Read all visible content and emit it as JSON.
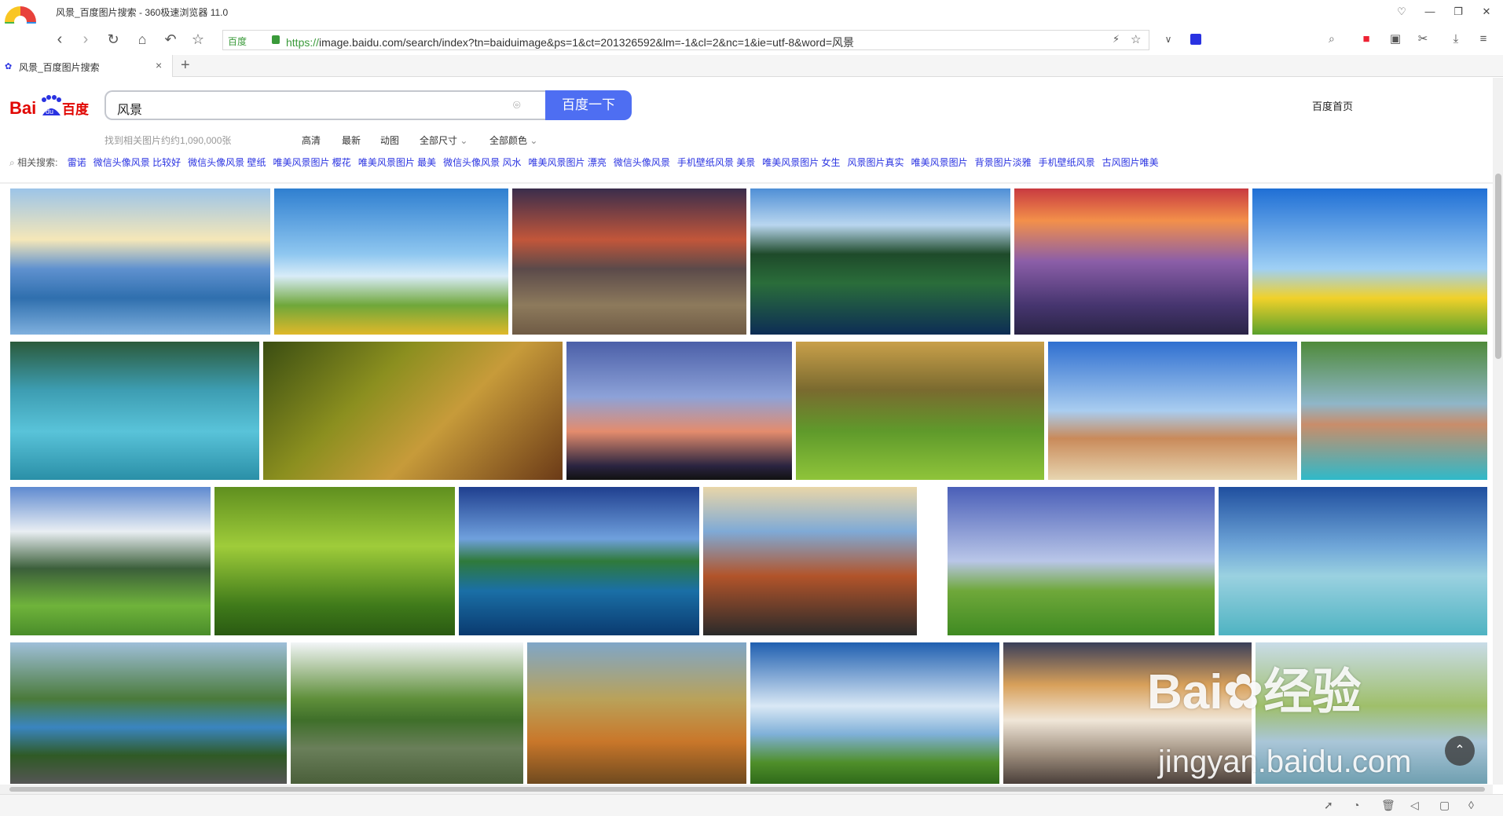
{
  "window": {
    "title": "风景_百度图片搜索 - 360极速浏览器 11.0"
  },
  "address_bar": {
    "site_badge": "百度",
    "url_scheme": "https://",
    "url_rest": "image.baidu.com/search/index?tn=baiduimage&ps=1&ct=201326592&lm=-1&cl=2&nc=1&ie=utf-8&word=风景"
  },
  "tab": {
    "label": "风景_百度图片搜索",
    "favicon": "baidu-paw-icon"
  },
  "page": {
    "logo_text": "Bai百度",
    "search": {
      "query": "风景",
      "button_label": "百度一下"
    },
    "home_link": "百度首页",
    "result_count": "找到相关图片约约1,090,000张",
    "filters": [
      "高清",
      "最新",
      "动图",
      "全部尺寸",
      "全部颜色"
    ],
    "related_label": "相关搜索:",
    "related_links": [
      "雷诺",
      "微信头像风景 比较好",
      "微信头像风景 壁纸",
      "唯美风景图片 樱花",
      "唯美风景图片 最美",
      "微信头像风景 风水",
      "唯美风景图片 漂亮",
      "微信头像风景",
      "手机壁纸风景 美景",
      "唯美风景图片 女生",
      "风景图片真实",
      "唯美风景图片",
      "背景图片淡雅",
      "手机壁纸风景",
      "古风图片唯美"
    ]
  },
  "images": [
    {
      "name": "lake-sky-reflection",
      "bg": "linear-gradient(180deg,#9cc4e8 0%,#f5e7b8 35%,#5f91cf 55%,#2f6fae 75%,#7fb0de 100%)"
    },
    {
      "name": "sunflowers-city",
      "bg": "linear-gradient(180deg,#2f7fd0 0%,#8fc7f0 45%,#d8ecf8 60%,#6fa73a 80%,#e0b82a 100%)"
    },
    {
      "name": "sunset-hills",
      "bg": "linear-gradient(180deg,#3a2d4c 0%,#c2563a 35%,#5b4a4a 55%,#8d7a5c 80%,#6f5b45 100%)"
    },
    {
      "name": "mountain-forest-lake",
      "bg": "linear-gradient(180deg,#4f8fd6 0%,#b9d6ef 25%,#1e4a2a 45%,#2a6d3a 65%,#0d2d55 100%)"
    },
    {
      "name": "pink-sunset-sea",
      "bg": "linear-gradient(180deg,#c83a40 0%,#f3904a 22%,#8b5ea8 50%,#46356f 80%,#2a2445 100%)"
    },
    {
      "name": "butterfly-flowers",
      "bg": "linear-gradient(180deg,#1f6fd5 0%,#9fd0f5 55%,#f1d12a 75%,#5aa12c 100%)"
    },
    {
      "name": "turquoise-lake",
      "bg": "linear-gradient(180deg,#2b5a3b 0%,#3d9db2 35%,#59c3d9 65%,#2a8fa7 100%)"
    },
    {
      "name": "autumn-forest-path",
      "bg": "linear-gradient(135deg,#3a4d12 0%,#8b8f1f 35%,#c79b3a 60%,#6b3a17 100%)"
    },
    {
      "name": "sun-rays-sky",
      "bg": "linear-gradient(180deg,#4b5fa8 0%,#8da2d8 40%,#e48c6d 65%,#2a2440 90%,#111 100%)"
    },
    {
      "name": "sunlit-woods",
      "bg": "linear-gradient(180deg,#c9a04a 0%,#7a6a2f 35%,#5f9a2b 65%,#8fc43a 100%)"
    },
    {
      "name": "desert-rock",
      "bg": "linear-gradient(180deg,#2f6fd0 0%,#a9cdf0 50%,#c98a5a 70%,#e7d5b0 100%)"
    },
    {
      "name": "lakeside-village",
      "bg": "linear-gradient(180deg,#4f8a3a 0%,#8fb6c9 45%,#c98d6a 60%,#2fb9c9 100%)"
    },
    {
      "name": "alpine-chalet",
      "bg": "linear-gradient(180deg,#5f8ad0 0%,#e9eef3 30%,#3b5f3a 55%,#6fb33b 80%,#4a8d2a 100%)"
    },
    {
      "name": "grass-closeup",
      "bg": "linear-gradient(180deg,#5f8f1f 0%,#9fcc3a 40%,#3f7a1a 80%,#2a5a12 100%)"
    },
    {
      "name": "island-sea",
      "bg": "linear-gradient(180deg,#1f3f8f 0%,#6fa0dd 35%,#2f7a3a 50%,#1a6fa6 70%,#0a3a6f 100%)"
    },
    {
      "name": "cliff-clouds",
      "bg": "linear-gradient(180deg,#e9d6a8 0%,#7faad6 30%,#b2542a 60%,#2a2a2a 100%)"
    },
    {
      "name": "white-chapel-meadow",
      "bg": "linear-gradient(180deg,#4a5fb8 0%,#b9c6e8 50%,#6fa83a 70%,#3f8a22 100%)"
    },
    {
      "name": "boat-clear-water",
      "bg": "linear-gradient(180deg,#1f4f9f 0%,#6fa6d8 40%,#9ad1e0 60%,#4fb3c2 100%)"
    },
    {
      "name": "valley-lake-road",
      "bg": "linear-gradient(180deg,#9fbfd9 0%,#4a7a3a 40%,#3a85c0 60%,#2f5a25 80%,#555 100%)"
    },
    {
      "name": "river-trees-reflection",
      "bg": "linear-gradient(180deg,#f2f5f7 0%,#5f8f3a 40%,#3f6f2a 55%,#6a7f5a 75%,#4a5f3a 100%)"
    },
    {
      "name": "painted-village",
      "bg": "linear-gradient(180deg,#7fa6c8 0%,#b9a25a 40%,#c9772a 70%,#6f4a1f 100%)"
    },
    {
      "name": "moon-fantasy",
      "bg": "linear-gradient(180deg,#1f5fb0 0%,#d9e8f5 45%,#7fb0d8 65%,#4f8f2a 85%,#2f6a1a 100%)"
    },
    {
      "name": "snowy-peaks-clouds",
      "bg": "linear-gradient(180deg,#3a3f5a 0%,#d8a05a 30%,#f0e6d8 55%,#9a8a7a 80%,#4a3f3a 100%)"
    },
    {
      "name": "willow-lake",
      "bg": "linear-gradient(180deg,#c9dce8 0%,#9fbf6a 45%,#aac6d8 70%,#6f9fb0 100%)"
    }
  ]
}
